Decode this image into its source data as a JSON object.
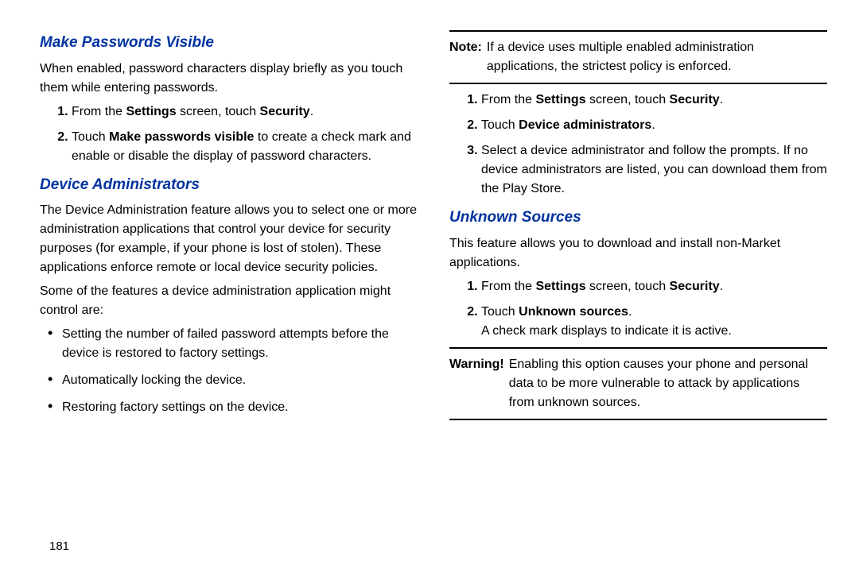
{
  "pageNumber": "181",
  "left": {
    "h1": "Make Passwords Visible",
    "p1": "When enabled, password characters display briefly as you touch them while entering passwords.",
    "ol1": {
      "i1_pre": "From the ",
      "i1_b1": "Settings",
      "i1_mid": " screen, touch ",
      "i1_b2": "Security",
      "i1_post": ".",
      "i2_pre": "Touch ",
      "i2_b": "Make passwords visible",
      "i2_post": " to create a check mark and enable or disable the display of password characters."
    },
    "h2": "Device Administrators",
    "p2": "The Device Administration feature allows you to select one or more administration applications that control your device for security purposes (for example, if your phone is lost of stolen). These applications enforce remote or local device security policies.",
    "p3": "Some of the features a device administration application might control are:",
    "ul": {
      "i1": "Setting the number of failed password attempts before the device is restored to factory settings.",
      "i2": "Automatically locking the device.",
      "i3": "Restoring factory settings on the device."
    }
  },
  "right": {
    "note_label": "Note:",
    "note_text": "If a device uses multiple enabled administration applications, the strictest policy is enforced.",
    "ol1": {
      "i1_pre": "From the ",
      "i1_b1": "Settings",
      "i1_mid": " screen, touch ",
      "i1_b2": "Security",
      "i1_post": ".",
      "i2_pre": "Touch ",
      "i2_b": "Device administrators",
      "i2_post": ".",
      "i3": "Select a device administrator and follow the prompts. If no device administrators are listed, you can download them from the Play Store."
    },
    "h1": "Unknown Sources",
    "p1": "This feature allows you to download and install non-Market applications.",
    "ol2": {
      "i1_pre": "From the ",
      "i1_b1": "Settings",
      "i1_mid": " screen, touch ",
      "i1_b2": "Security",
      "i1_post": ".",
      "i2_pre": "Touch ",
      "i2_b": "Unknown sources",
      "i2_post": ".",
      "i2_tail": "A check mark displays to indicate it is active."
    },
    "warn_label": "Warning!",
    "warn_text": "Enabling this option causes your phone and personal data to be more vulnerable to attack by applications from unknown sources."
  }
}
